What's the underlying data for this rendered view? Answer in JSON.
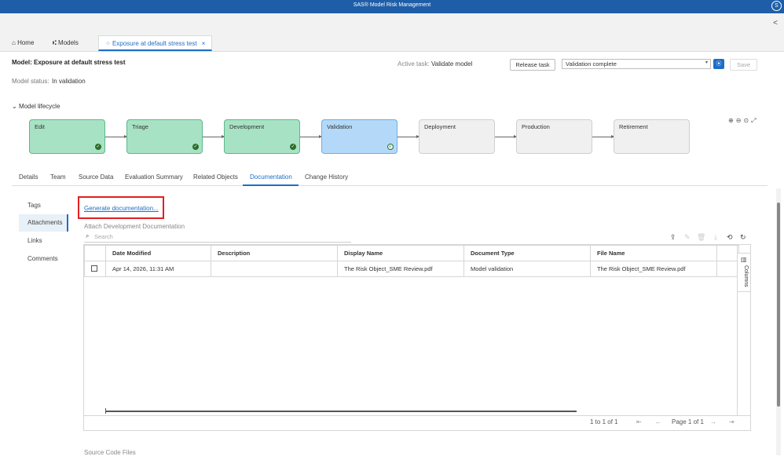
{
  "app": {
    "title": "SAS® Model Risk Management",
    "user_initial": "S"
  },
  "tabs": [
    {
      "label": "Home",
      "icon": "home-icon"
    },
    {
      "label": "Models",
      "icon": "models-icon"
    },
    {
      "label": "Exposure at default stress test",
      "icon": "workflow-icon",
      "close": "×"
    }
  ],
  "header": {
    "title": "Model: Exposure at default stress test",
    "status_label": "Model status:",
    "status_value": "In validation",
    "active_task_label": "Active task:",
    "active_task_value": "Validate model",
    "release_button": "Release task",
    "selected_action": "Validation complete",
    "save_button": "Save"
  },
  "lifecycle": {
    "label": "Model lifecycle",
    "stages": [
      {
        "name": "Edit",
        "state": "done"
      },
      {
        "name": "Triage",
        "state": "done"
      },
      {
        "name": "Development",
        "state": "done"
      },
      {
        "name": "Validation",
        "state": "active"
      },
      {
        "name": "Deployment",
        "state": "todo"
      },
      {
        "name": "Production",
        "state": "todo"
      },
      {
        "name": "Retirement",
        "state": "todo"
      }
    ]
  },
  "page_tabs": [
    "Details",
    "Team",
    "Source Data",
    "Evaluation Summary",
    "Related Objects",
    "Documentation",
    "Change History"
  ],
  "active_page_tab": "Documentation",
  "side_nav": [
    "Tags",
    "Attachments",
    "Links",
    "Comments"
  ],
  "active_side": "Attachments",
  "documentation": {
    "generate_link": "Generate documentation...",
    "section_title": "Attach Development Documentation",
    "search_placeholder": "Search",
    "columns": [
      "Date Modified",
      "Description",
      "Display Name",
      "Document Type",
      "File Name"
    ],
    "rows": [
      {
        "date_modified": "Apr 14, 2026, 11:31 AM",
        "description": "",
        "display_name": "The Risk Object_SME Review.pdf",
        "document_type": "Model validation",
        "file_name": "The Risk Object_SME Review.pdf"
      }
    ],
    "columns_panel_label": "Columns",
    "range": "1 to 1 of 1",
    "page": "Page 1 of 1",
    "source_code_title": "Source Code Files"
  },
  "colors": {
    "accent": "#1e6ec8",
    "topbar": "#1e5ea8",
    "done": "#a8e2c4",
    "active": "#b4d9f8",
    "highlight": "#e02020"
  }
}
